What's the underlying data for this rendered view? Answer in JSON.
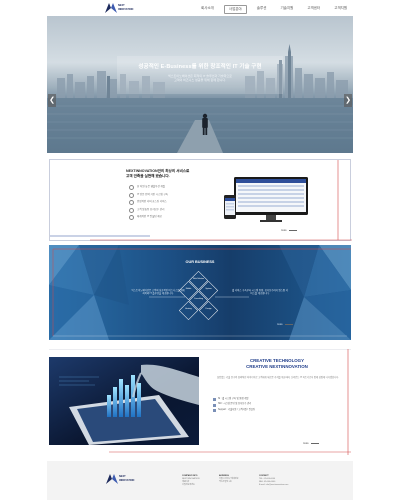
{
  "header": {
    "logo_text_1": "NEXT",
    "logo_text_2": "INNOVATION",
    "nav": [
      "회사소개",
      "사업분야",
      "솔루션",
      "기술지원",
      "고객센터",
      "고객지원"
    ]
  },
  "hero": {
    "title": "성공적인 E-Business를 위한 창조적인 IT 기술 구현",
    "sub_1": "넥스트이노베이션은 최적의 IT 솔루션과 기술력으로",
    "sub_2": "고객의 비즈니스 성공을 위해 함께 합니다.",
    "prev": "❮",
    "next": "❯"
  },
  "intro": {
    "title_1": "NEXTINNOVATION만의 최상의 서비스로",
    "title_2": "고객 만족을 실현해 왔습니다.",
    "features": [
      "한 차원 높은 웹솔루션 개발",
      "IT 전문 인력 기반 시스템 구축",
      "안정적인 서버 호스팅 서비스",
      "고객 맞춤형 유지보수 관리",
      "체계적인 IT 컨설팅 제공"
    ],
    "more": "more"
  },
  "business": {
    "title": "OUR BUSINESS",
    "left_text": "넥스트이노베이션은 고객의 성공적인 비즈니스를 위해 최적의 IT 솔루션을 제공합니다.",
    "right_text": "웹 서비스 구축부터 시스템 통합, 유지보수까지 원스톱 서비스를 제공합니다.",
    "diamonds": [
      "Web Solution",
      "Mobile",
      "System",
      "Consulting",
      "Hosting",
      "Design"
    ],
    "more": "more"
  },
  "creative": {
    "title_1": "CREATIVE TECHNOLOGY",
    "title_2": "CREATIVE NEXTINNOVATION",
    "body": "끊임없는 기술 연구와 창의적인 아이디어로 고객에게 새로운 가치를 제공하며, 신뢰받는 IT 파트너로서 함께 성장해 나가겠습니다.",
    "items": [
      "SI : 웹 시스템 구축 및 통합 개발",
      "SM : 시스템 운영 및 유지보수 관리",
      "Support : 기술지원 / 고객지원 / 컨설팅"
    ],
    "more": "more"
  },
  "footer": {
    "col1_head": "COMPANY INFO",
    "col1": [
      "NEXTINNOVATION",
      "대표이사",
      "사업자등록번호"
    ],
    "col2_head": "ADDRESS",
    "col2": [
      "서울시 강남구 테헤란로",
      "넥스트빌딩 5층",
      ""
    ],
    "col3_head": "CONTACT",
    "col3": [
      "TEL. 02-000-0000",
      "FAX. 02-000-0000",
      "E-mail. info@nextinnovation.com"
    ]
  },
  "colors": {
    "brand": "#1d2a5c",
    "accent_red": "#d44a4a",
    "accent_blue": "#2c4a9a",
    "business_bg": "#1c4f84"
  }
}
